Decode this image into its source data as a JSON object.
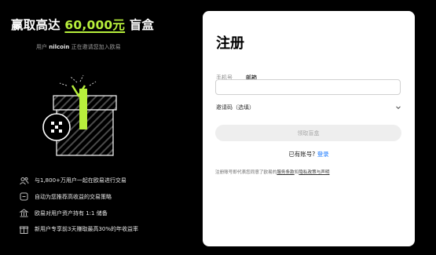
{
  "promo": {
    "title_prefix": "赢取高达 ",
    "amount": "60,000元",
    "title_suffix": " 盲盒",
    "invite_prefix": "用户 ",
    "invite_user": "nilcoin",
    "invite_suffix": " 正在邀请您加入欧易"
  },
  "features": [
    {
      "icon": "users-icon",
      "text": "与1,800+万用户一起在欧易进行交易"
    },
    {
      "icon": "strategy-icon",
      "text": "自动为您推荐高收益的交易策略"
    },
    {
      "icon": "reserve-icon",
      "text": "欧易对用户资产持有 1:1 储备"
    },
    {
      "icon": "gift-rate-icon",
      "text": "新用户专享前3天赚取最高30%的年收益率"
    }
  ],
  "form": {
    "title": "注册",
    "tabs": [
      {
        "label": "手机号",
        "active": false
      },
      {
        "label": "邮箱",
        "active": true
      }
    ],
    "email_value": "",
    "email_placeholder": "",
    "referral_label": "邀请码（选填）",
    "submit_label": "领取盲盒",
    "have_account": "已有账号?",
    "login_label": "登录",
    "terms_prefix": "注册账号即代表您同意了欧易的",
    "terms_link": "服务条款",
    "terms_and": "和",
    "privacy_link": "隐私政策与声明"
  },
  "colors": {
    "accent": "#b8f03c",
    "link": "#1677ff",
    "panel": "#ffffff",
    "background": "#000000"
  }
}
